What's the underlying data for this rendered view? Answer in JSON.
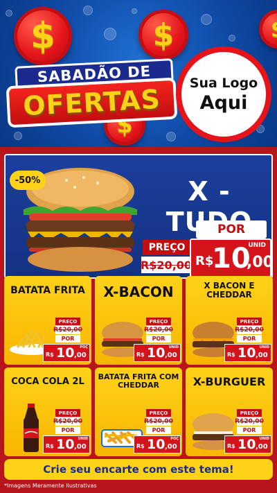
{
  "header": {
    "title_top": "SABADÃO DE",
    "title_main": "OFERTAS",
    "coin_symbol": "$",
    "logo_line1": "Sua Logo",
    "logo_line2": "Aqui"
  },
  "hero": {
    "discount": "-50%",
    "name": "X - TUDO",
    "preco_label": "PREÇO",
    "old_price": "R$20,00",
    "por_label": "POR",
    "unit": "UNID",
    "currency": "R$",
    "new_price_int": "10",
    "new_price_cents": ",00"
  },
  "products": [
    {
      "title": "BATATA FRITA",
      "preco_label": "PREÇO",
      "old_price": "R$20,00",
      "por_label": "POR",
      "unit": "POÇ",
      "currency": "R$",
      "price_int": "10",
      "price_cents": ",00",
      "image": "fries"
    },
    {
      "title": "X-BACON",
      "preco_label": "PREÇO",
      "old_price": "R$20,00",
      "por_label": "POR",
      "unit": "UNID",
      "currency": "R$",
      "price_int": "10",
      "price_cents": ",00",
      "image": "burger"
    },
    {
      "title": "X BACON E CHEDDAR",
      "preco_label": "PREÇO",
      "old_price": "R$20,00",
      "por_label": "POR",
      "unit": "UNID",
      "currency": "R$",
      "price_int": "10",
      "price_cents": ",00",
      "image": "cheddar-burger"
    },
    {
      "title": "COCA COLA 2L",
      "preco_label": "PREÇO",
      "old_price": "R$20,00",
      "por_label": "POR",
      "unit": "UNID",
      "currency": "R$",
      "price_int": "10",
      "price_cents": ",00",
      "image": "soda-bottle"
    },
    {
      "title": "BATATA FRITA COM CHEDDAR",
      "preco_label": "PREÇO",
      "old_price": "R$20,00",
      "por_label": "POR",
      "unit": "POÇ",
      "currency": "R$",
      "price_int": "10",
      "price_cents": ",00",
      "image": "cheddar-fries"
    },
    {
      "title": "X-BURGUER",
      "preco_label": "PREÇO",
      "old_price": "R$20,00",
      "por_label": "POR",
      "unit": "UNID",
      "currency": "R$",
      "price_int": "10",
      "price_cents": ",00",
      "image": "burger"
    }
  ],
  "cta": "Crie seu encarte com este tema!",
  "disclaimer": "*Imagens Meramente Ilustrativas",
  "colors": {
    "red": "#c30d10",
    "yellow": "#ffd21a",
    "blue": "#143282"
  }
}
